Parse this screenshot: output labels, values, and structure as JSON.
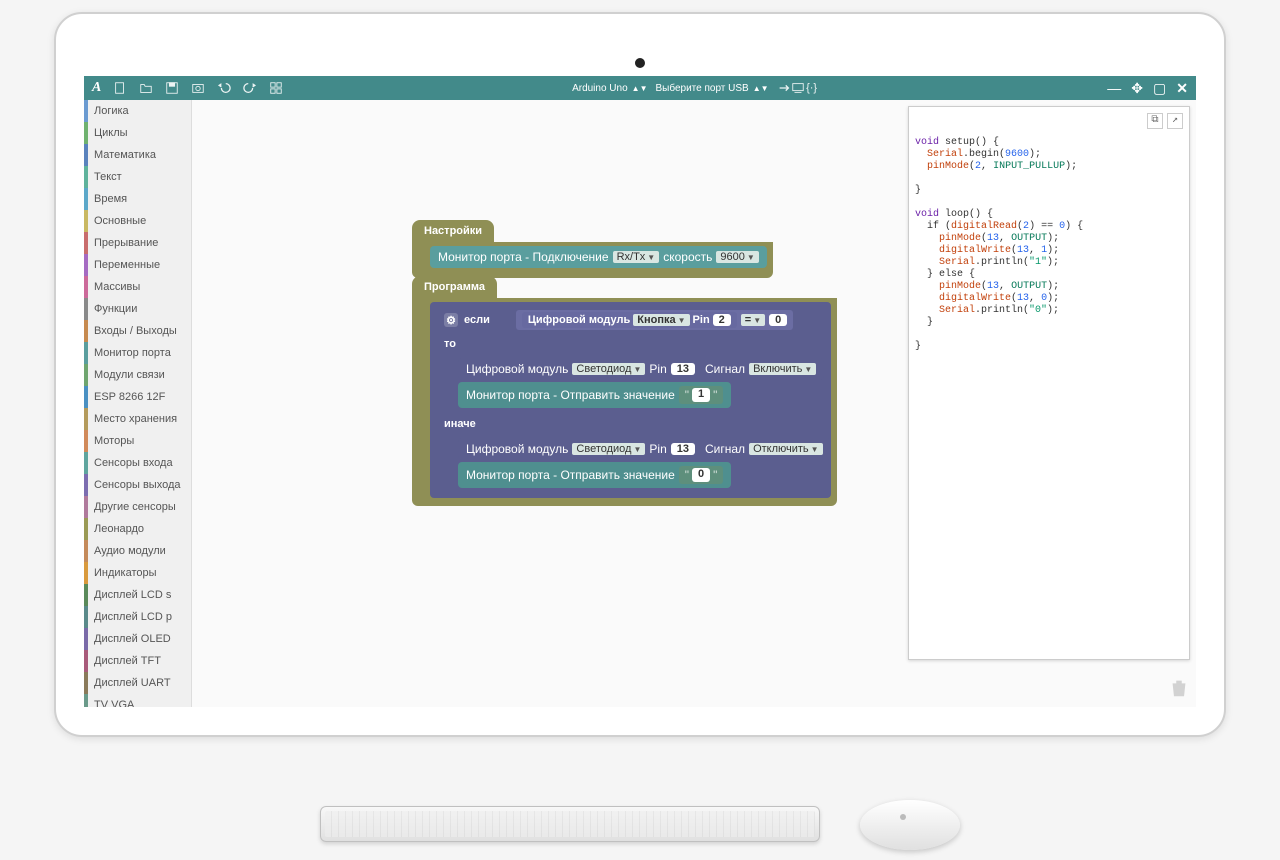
{
  "toolbar": {
    "board": "Arduino Uno",
    "port": "Выберите порт USB"
  },
  "categories": [
    {
      "label": "Логика",
      "color": "#6b9bd1"
    },
    {
      "label": "Циклы",
      "color": "#6fb26f"
    },
    {
      "label": "Математика",
      "color": "#5a83bd"
    },
    {
      "label": "Текст",
      "color": "#5fb39c"
    },
    {
      "label": "Время",
      "color": "#5ca8c9"
    },
    {
      "label": "Основные",
      "color": "#c9b862"
    },
    {
      "label": "Прерывание",
      "color": "#c96d6d"
    },
    {
      "label": "Переменные",
      "color": "#a56bc2"
    },
    {
      "label": "Массивы",
      "color": "#cc6a9a"
    },
    {
      "label": "Функции",
      "color": "#8a8a8a"
    },
    {
      "label": "Входы / Выходы",
      "color": "#c68a4f"
    },
    {
      "label": "Монитор порта",
      "color": "#5a9e9e"
    },
    {
      "label": "Модули связи",
      "color": "#6fa56f"
    },
    {
      "label": "ESP 8266 12F",
      "color": "#4a90c2"
    },
    {
      "label": "Место хранения",
      "color": "#b49b5c"
    },
    {
      "label": "Моторы",
      "color": "#d18a5a"
    },
    {
      "label": "Сенсоры входа",
      "color": "#5fa59e"
    },
    {
      "label": "Сенсоры выхода",
      "color": "#7c6db0"
    },
    {
      "label": "Другие сенсоры",
      "color": "#b07a9c"
    },
    {
      "label": "Леонардо",
      "color": "#9a9a55"
    },
    {
      "label": "Аудио модули",
      "color": "#c48a5a"
    },
    {
      "label": "Индикаторы",
      "color": "#d99a3d"
    },
    {
      "label": "Дисплей LCD s",
      "color": "#5a8a5a"
    },
    {
      "label": "Дисплей LCD p",
      "color": "#5a8a8a"
    },
    {
      "label": "Дисплей OLED",
      "color": "#7a6aa8"
    },
    {
      "label": "Дисплей TFT",
      "color": "#a85a7a"
    },
    {
      "label": "Дисплей UART",
      "color": "#8a7a5a"
    },
    {
      "label": "TV VGA",
      "color": "#6a9a8a"
    }
  ],
  "blocks": {
    "settings_hat": "Настройки",
    "program_hat": "Программа",
    "serial_connect": "Монитор порта - Подключение",
    "rxtx": "Rx/Tx",
    "speed_label": "скорость",
    "speed_value": "9600",
    "if_label": "если",
    "then_label": "то",
    "else_label": "иначе",
    "digital_module": "Цифровой модуль",
    "button": "Кнопка",
    "led": "Светодиод",
    "pin_label": "Pin",
    "signal_label": "Сигнал",
    "signal_on": "Включить",
    "signal_off": "Отключить",
    "eq": "=",
    "cmp_val": "0",
    "button_pin": "2",
    "led_pin": "13",
    "serial_send": "Монитор порта - Отправить значение",
    "send_val_1": "1",
    "send_val_0": "0"
  },
  "code": {
    "l1a": "void",
    "l1b": " setup() {",
    "l2a": "  Serial",
    "l2b": ".begin(",
    "l2c": "9600",
    "l2d": ");",
    "l3a": "  pinMode",
    "l3b": "(",
    "l3c": "2",
    "l3d": ", ",
    "l3e": "INPUT_PULLUP",
    "l3f": ");",
    "l4": "",
    "l5": "}",
    "l6": "",
    "l7a": "void",
    "l7b": " loop() {",
    "l8a": "  if (",
    "l8b": "digitalRead",
    "l8c": "(",
    "l8d": "2",
    "l8e": ") == ",
    "l8f": "0",
    "l8g": ") {",
    "l9a": "    pinMode",
    "l9b": "(",
    "l9c": "13",
    "l9d": ", ",
    "l9e": "OUTPUT",
    "l9f": ");",
    "l10a": "    digitalWrite",
    "l10b": "(",
    "l10c": "13",
    "l10d": ", ",
    "l10e": "1",
    "l10f": ");",
    "l11a": "    Serial",
    "l11b": ".println(",
    "l11c": "\"1\"",
    "l11d": ");",
    "l12": "  } else {",
    "l13a": "    pinMode",
    "l13b": "(",
    "l13c": "13",
    "l13d": ", ",
    "l13e": "OUTPUT",
    "l13f": ");",
    "l14a": "    digitalWrite",
    "l14b": "(",
    "l14c": "13",
    "l14d": ", ",
    "l14e": "0",
    "l14f": ");",
    "l15a": "    Serial",
    "l15b": ".println(",
    "l15c": "\"0\"",
    "l15d": ");",
    "l16": "  }",
    "l17": "",
    "l18": "}"
  }
}
